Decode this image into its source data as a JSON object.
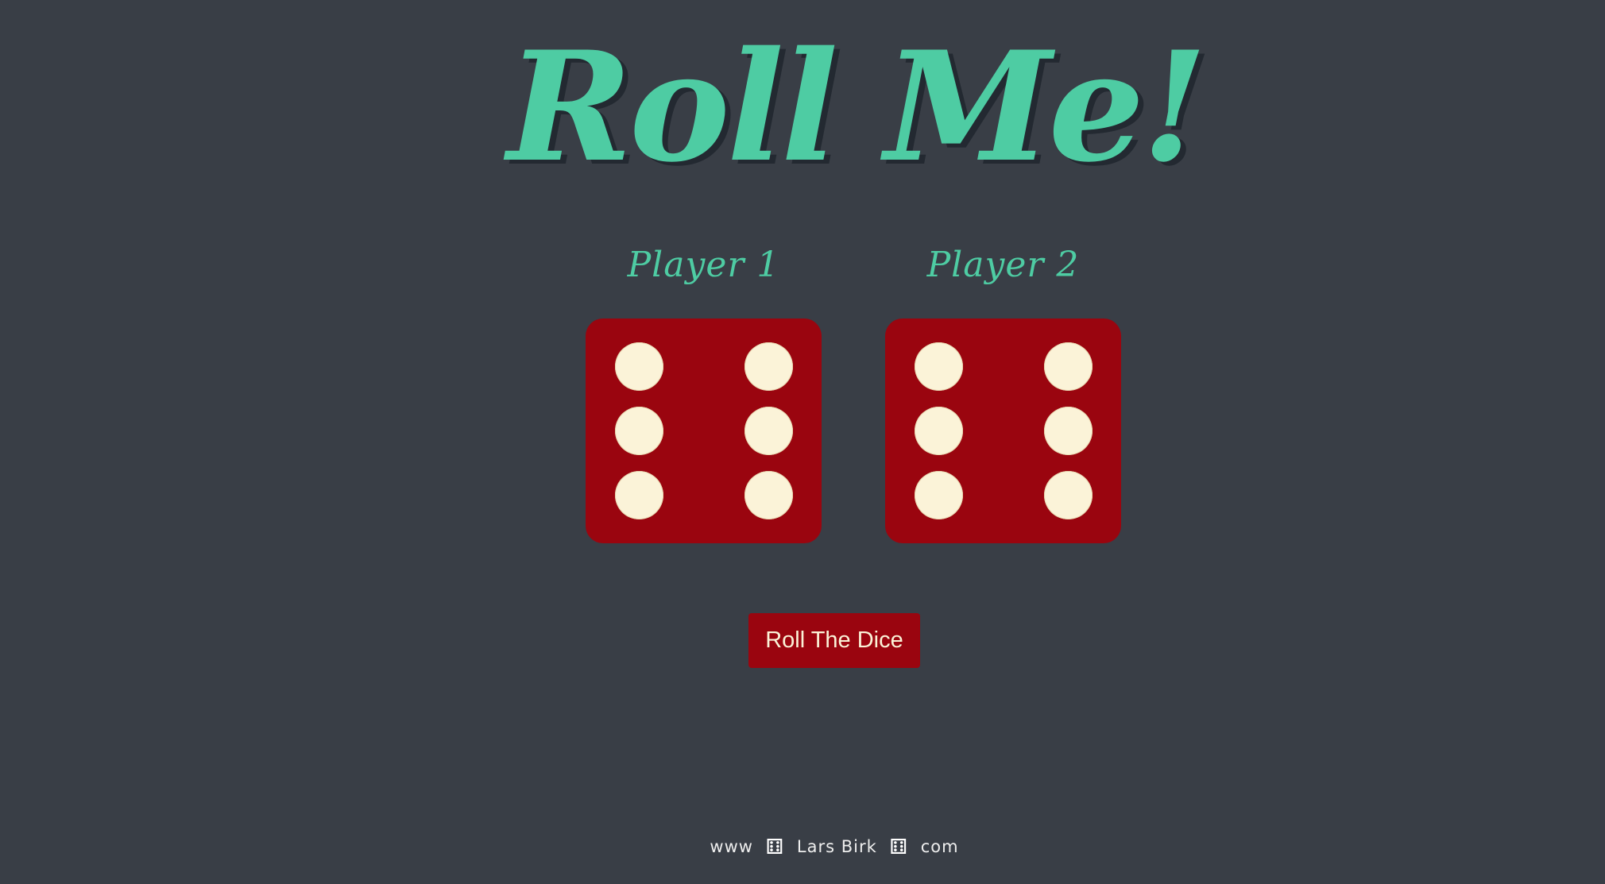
{
  "title": "Roll Me!",
  "players": [
    {
      "label": "Player 1",
      "die_value": 6
    },
    {
      "label": "Player 2",
      "die_value": 6
    }
  ],
  "button": {
    "label": "Roll The Dice"
  },
  "footer": {
    "part1": "www",
    "part2": "Lars Birk",
    "part3": "com",
    "separator_icon": "dice-icon"
  },
  "colors": {
    "background": "#393e46",
    "accent": "#4ecca3",
    "die": "#9a050f",
    "pip": "#fbf3d8"
  }
}
